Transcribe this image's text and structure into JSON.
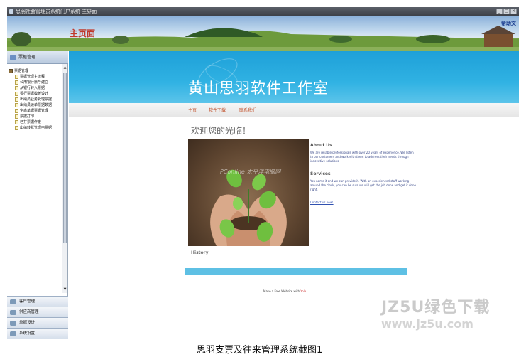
{
  "window": {
    "title": "思羽社会管理员系统门户系统 主界面",
    "buttons": [
      "_",
      "□",
      "×"
    ]
  },
  "banner": {
    "title": "主页面",
    "help": "帮助文"
  },
  "sidebar": {
    "header": "票据管理",
    "tree_root": "票据管理",
    "items": [
      "票据管理主流程",
      "公用银行账号建立",
      "从银行转入票据",
      "银行票据模板设计",
      "出纳员业务受理票据",
      "出纳员读单票据数据",
      "空白单据票据管理",
      "票据打印",
      "已打票据作废",
      "出纳转账管理电票据"
    ],
    "sections": [
      "客户管理",
      "供应商管理",
      "单据设计",
      "系统设置"
    ]
  },
  "content": {
    "site_title": "黄山思羽软件工作室",
    "nav": [
      "主页",
      "软件下载",
      "联系我们"
    ],
    "welcome": "欢迎您的光临！",
    "photo_watermark": "PConline 太平洋电脑网",
    "about_title": "About Us",
    "about_text": "We are reliable professionals with over 20 years of experience. We listen to our customers and work with them to address their needs through innovative solutions.",
    "services_title": "Services",
    "services_text": "You name it and we can provide it. With an experienced staff working around the clock, you can be sure we will get the job done and get it done right.",
    "contact": "Contact us now!",
    "history": "History",
    "made_with_prefix": "Make a Free Website with",
    "made_with_brand": "Yola"
  },
  "caption": "思羽支票及往来管理系统截图1",
  "site_watermark": {
    "line1": "JZ5U绿色下载",
    "line2": "www.jz5u.com"
  }
}
